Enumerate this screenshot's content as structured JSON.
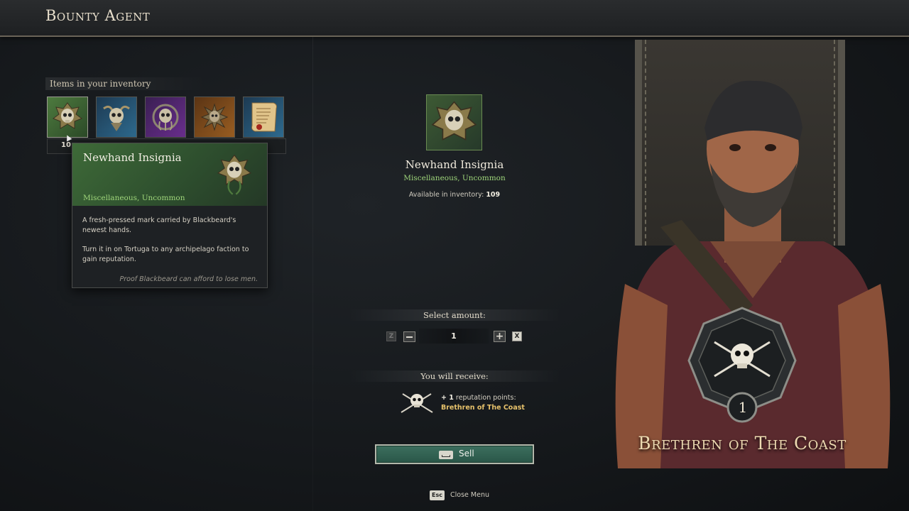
{
  "header": {
    "title": "Bounty Agent"
  },
  "inventory": {
    "label": "Items in your inventory",
    "items": [
      {
        "name": "Newhand Insignia",
        "icon": "skull-insignia-icon",
        "bg": "#3f6a34",
        "count": "10"
      },
      {
        "name": "",
        "icon": "skull-horns-icon",
        "bg": "#1f4e6e"
      },
      {
        "name": "",
        "icon": "skull-tentacles-icon",
        "bg": "#5a2a7a"
      },
      {
        "name": "",
        "icon": "kraken-icon",
        "bg": "#7a4a18"
      },
      {
        "name": "",
        "icon": "scroll-icon",
        "bg": "#1f4e6e"
      }
    ]
  },
  "tooltip": {
    "name": "Newhand Insignia",
    "category": "Miscellaneous, Uncommon",
    "desc1": "A fresh-pressed mark carried by Blackbeard's newest hands.",
    "desc2": "Turn it in on Tortuga to any archipelago faction to gain reputation.",
    "flavor": "Proof Blackbeard can afford to lose men."
  },
  "selected": {
    "name": "Newhand Insignia",
    "category": "Miscellaneous, Uncommon",
    "available_label": "Available in inventory:",
    "available_count": "109"
  },
  "amount": {
    "label": "Select amount:",
    "key_left": "Z",
    "key_right": "X",
    "value": "1"
  },
  "receive": {
    "label": "You will receive:",
    "points_prefix": "+ 1",
    "points_text": "reputation points:",
    "faction": "Brethren of The Coast"
  },
  "sell": {
    "label": "Sell"
  },
  "footer": {
    "esc_key": "Esc",
    "close_label": "Close Menu"
  },
  "faction": {
    "name": "Brethren of The Coast",
    "rank": "1"
  },
  "colors": {
    "accent_green": "#9ed57a",
    "gold": "#e6c16b",
    "sell_button": "#3c6f5e"
  }
}
